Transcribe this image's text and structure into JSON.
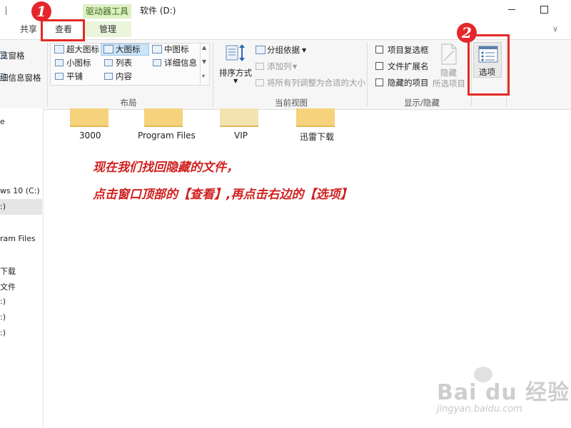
{
  "titlebar": {
    "separator_glyph": "|",
    "context_tab_label": "驱动器工具",
    "window_title": "软件 (D:)"
  },
  "tabs": {
    "share": "共享",
    "view": "查看",
    "manage": "管理"
  },
  "ribbon": {
    "pane_group": {
      "preview_pane": "览窗格",
      "details_pane": "细信息窗格"
    },
    "layout_group": {
      "label": "布局",
      "items": {
        "extra_large_icons": "超大图标",
        "large_icons": "大图标",
        "medium_icons": "中图标",
        "small_icons": "小图标",
        "list": "列表",
        "details": "详细信息",
        "tiles": "平铺",
        "content": "内容"
      }
    },
    "current_view_group": {
      "label": "当前视图",
      "sort_by": "排序方式",
      "group_by": "分组依据",
      "add_columns": "添加列",
      "size_all_columns": "将所有列调整为合适的大小"
    },
    "show_hide_group": {
      "label": "显示/隐藏",
      "item_check_boxes": "项目复选框",
      "file_name_extensions": "文件扩展名",
      "hidden_items": "隐藏的项目",
      "hide": "隐藏",
      "selected_items": "所选项目"
    },
    "options_button": "选项"
  },
  "nav": {
    "items": [
      "e",
      "ws 10 (C:)",
      ":)",
      "ram Files",
      "下载",
      "文件",
      ":)",
      ":)",
      ":)"
    ]
  },
  "folders": [
    "3000",
    "Program Files",
    "VIP",
    "迅雷下载"
  ],
  "annotation": {
    "line1": "现在我们找回隐藏的文件，",
    "line2": "点击窗口顶部的【查看】,再点击右边的【选项】"
  },
  "callouts": {
    "step1": "1",
    "step2": "2"
  },
  "watermark": {
    "logo": "Bai du 经验",
    "url": "jingyan.baidu.com"
  },
  "colors": {
    "callout_red": "#e32a25",
    "annotation_red": "#d0201f",
    "tool_tab_green": "#dff0c4"
  }
}
